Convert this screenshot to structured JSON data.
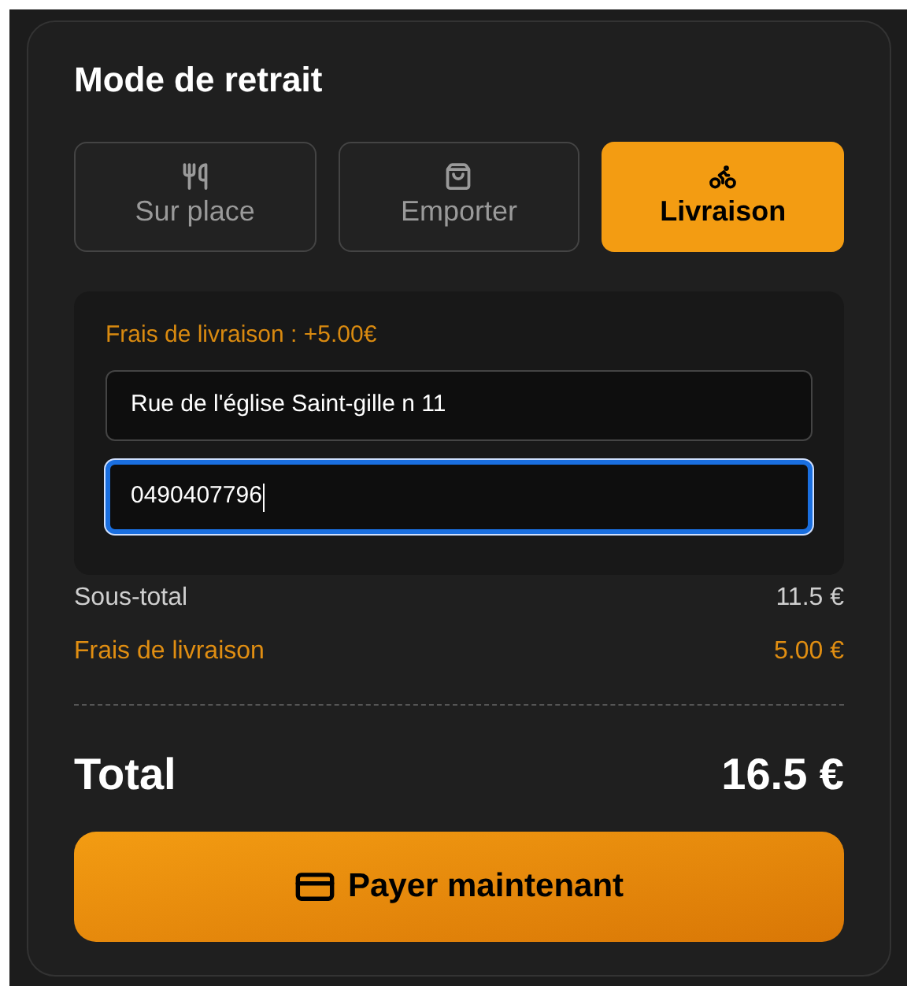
{
  "title": "Mode de retrait",
  "tabs": [
    {
      "label": "Sur place",
      "selected": false
    },
    {
      "label": "Emporter",
      "selected": false
    },
    {
      "label": "Livraison",
      "selected": true
    }
  ],
  "delivery": {
    "fee_note": "Frais de livraison : +5.00€",
    "fields": [
      {
        "value": "Rue de l'église Saint-gille n 11",
        "focused": false
      },
      {
        "value": "0490407796",
        "focused": true
      }
    ]
  },
  "summary": [
    {
      "label": "Sous-total",
      "value": "11.5 €",
      "kind": "normal"
    },
    {
      "label": "Frais de livraison",
      "value": "5.00 €",
      "kind": "fee"
    }
  ],
  "total": {
    "label": "Total",
    "value": "16.5 €"
  },
  "pay_button": "Payer maintenant"
}
